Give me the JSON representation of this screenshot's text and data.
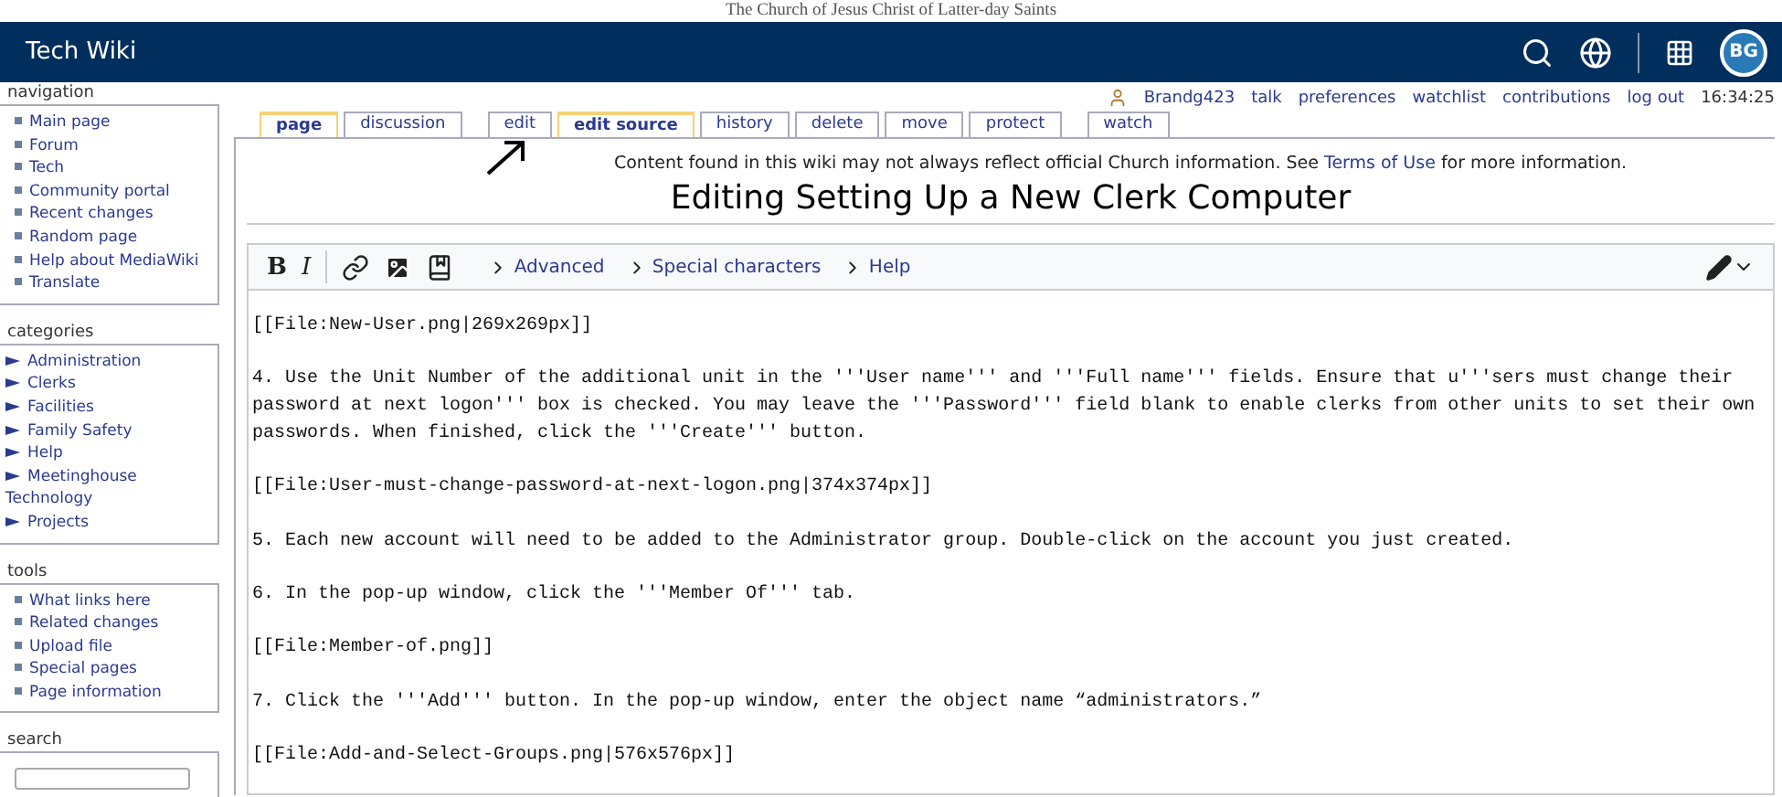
{
  "banner": {
    "text": "The Church of Jesus Christ of Latter-day Saints"
  },
  "header": {
    "site_title": "Tech Wiki",
    "avatar_initials": "BG"
  },
  "user_links": [
    "Brandg423",
    "talk",
    "preferences",
    "watchlist",
    "contributions",
    "log out"
  ],
  "clock": "16:34:25",
  "sidebar": [
    {
      "title": "navigation",
      "kind": "bullets",
      "items": [
        "Main page",
        "Forum",
        "Tech",
        "Community portal",
        "Recent changes",
        "Random page",
        "Help about MediaWiki",
        "Translate"
      ]
    },
    {
      "title": "categories",
      "kind": "tree",
      "items": [
        "Administration",
        "Clerks",
        "Facilities",
        "Family Safety",
        "Help",
        "Meetinghouse Technology",
        "Projects"
      ]
    },
    {
      "title": "tools",
      "kind": "bullets",
      "items": [
        "What links here",
        "Related changes",
        "Upload file",
        "Special pages",
        "Page information"
      ]
    },
    {
      "title": "search",
      "kind": "search"
    }
  ],
  "tab_groups": [
    [
      {
        "label": "page",
        "selected": true
      },
      {
        "label": "discussion",
        "selected": false
      }
    ],
    [
      {
        "label": "edit",
        "selected": false
      },
      {
        "label": "edit source",
        "selected": true
      },
      {
        "label": "history",
        "selected": false
      },
      {
        "label": "delete",
        "selected": false
      },
      {
        "label": "move",
        "selected": false
      },
      {
        "label": "protect",
        "selected": false
      }
    ],
    [
      {
        "label": "watch",
        "selected": false
      }
    ]
  ],
  "notice": {
    "before": "Content found in this wiki may not always reflect official Church information. See",
    "link": "Terms of Use",
    "after": "for more information."
  },
  "page_title": "Editing Setting Up a New Clerk Computer",
  "toolbar": {
    "bold": "B",
    "italic": "I",
    "menus": [
      "Advanced",
      "Special characters",
      "Help"
    ]
  },
  "editor_paragraphs": [
    "[[File:New-User.png|269x269px]]",
    "4. Use the Unit Number of the additional unit in the '''User name''' and '''Full name''' fields. Ensure that u'''sers must change their password at next logon''' box is checked. You may leave the '''Password''' field blank to enable clerks from other units to set their own passwords. When finished, click the '''Create''' button.",
    "[[File:User-must-change-password-at-next-logon.png|374x374px]]",
    "5. Each new account will need to be added to the Administrator group. Double-click on the account you just created.",
    "6. In the pop-up window, click the '''Member Of''' tab.",
    "[[File:Member-of.png]]",
    "7. Click the '''Add''' button. In the pop-up window, enter the object name “administrators.”",
    "[[File:Add-and-Select-Groups.png|576x576px]]"
  ]
}
